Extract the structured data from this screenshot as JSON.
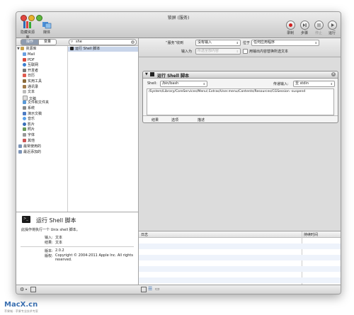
{
  "window": {
    "title": "锁屏 (服务)"
  },
  "toolbar": {
    "left_buttons": [
      {
        "label": "隐藏资源库",
        "icon": "library-icon"
      },
      {
        "label": "媒体",
        "icon": "media-icon"
      }
    ],
    "right_buttons": [
      {
        "label": "录制",
        "icon": "record-icon"
      },
      {
        "label": "步骤",
        "icon": "step-icon"
      },
      {
        "label": "停止",
        "icon": "stop-icon"
      },
      {
        "label": "运行",
        "icon": "run-icon"
      }
    ]
  },
  "library": {
    "tabs": [
      "操作",
      "变量"
    ],
    "search_value": "she",
    "root_label": "资源库",
    "items": [
      "Mail",
      "PDF",
      "互联网",
      "开发者",
      "日历",
      "实用工具",
      "通讯录",
      "文本",
      "文稿",
      "文件和文件夹",
      "系统",
      "演示文稿",
      "音乐",
      "影片",
      "照片",
      "字体",
      "其他"
    ],
    "extra_items": [
      "最常使用的",
      "最近添加的"
    ],
    "results": [
      "运行 Shell 脚本"
    ]
  },
  "description": {
    "title": "运行 Shell 脚本",
    "summary": "此操作将执行一个 Unix shell 脚本。",
    "input_label": "输入:",
    "input_value": "文本",
    "result_label": "结果:",
    "result_value": "文本",
    "version_label": "版本:",
    "version_value": "2.0.2",
    "copyright_label": "版权:",
    "copyright_value": "Copyright © 2004-2011 Apple Inc.  All rights reserved."
  },
  "service_bar": {
    "receives_label": "“服务”收到",
    "receives_value": "没有输入",
    "location_label": "位于",
    "location_value": "任何应用程序",
    "input_label": "输入为",
    "input_placeholder": "所选全部内容",
    "replace_label": "用输出内容替换所选文本"
  },
  "action": {
    "title": "运行 Shell 脚本",
    "shell_label": "Shell:",
    "shell_value": "/bin/bash",
    "pass_label": "传递输入:",
    "pass_value": "至 stdin",
    "script": "/System/Library/CoreServices/Menu\\ Extras/User.menu/Contents/Resources/CGSession -suspend",
    "footer_tabs": [
      "结果",
      "选项",
      "描述"
    ]
  },
  "log": {
    "col_log": "日志",
    "col_time": "持续时间"
  },
  "watermark": {
    "brand": "MacX.cn",
    "tagline": "苹果城 · 苹果专业技术专家"
  }
}
